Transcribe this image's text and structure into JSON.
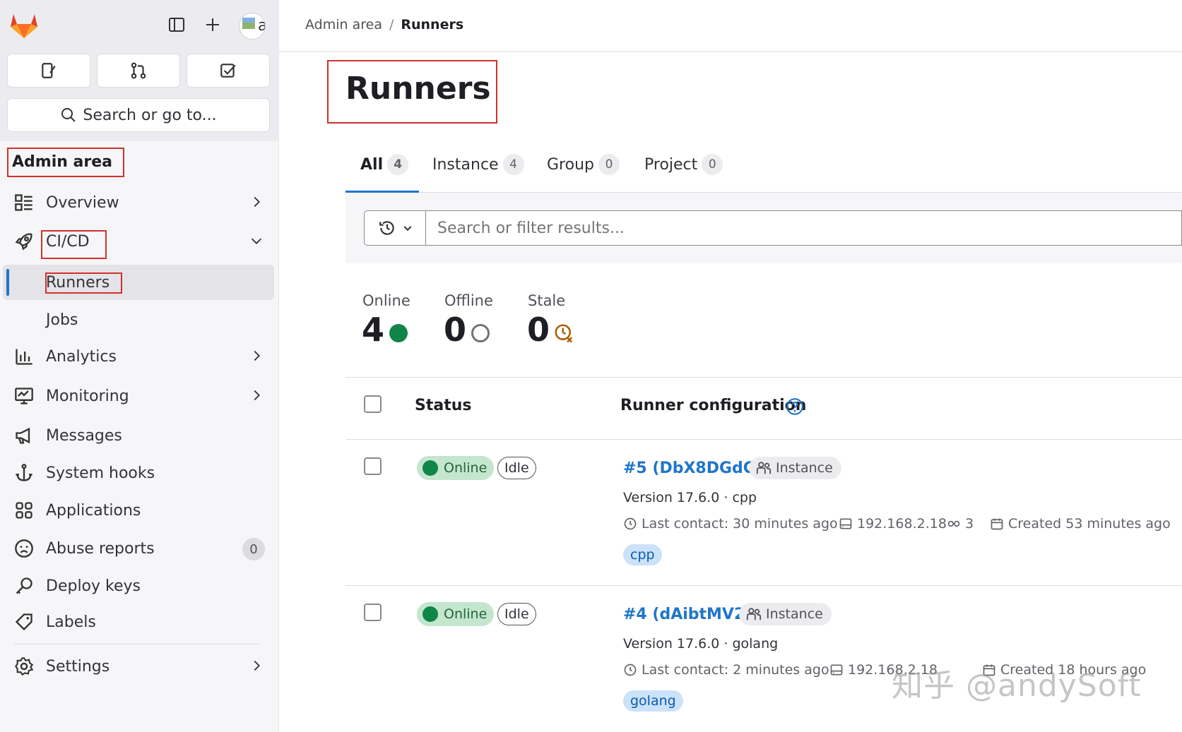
{
  "sidebar": {
    "avatar_alt": "a",
    "search_label": "Search or go to...",
    "section_title": "Admin area",
    "items": [
      {
        "label": "Overview"
      },
      {
        "label": "CI/CD"
      },
      {
        "label": "Runners"
      },
      {
        "label": "Jobs"
      },
      {
        "label": "Analytics"
      },
      {
        "label": "Monitoring"
      },
      {
        "label": "Messages"
      },
      {
        "label": "System hooks"
      },
      {
        "label": "Applications"
      },
      {
        "label": "Abuse reports",
        "badge": "0"
      },
      {
        "label": "Deploy keys"
      },
      {
        "label": "Labels"
      },
      {
        "label": "Settings"
      }
    ]
  },
  "breadcrumb": {
    "parent": "Admin area",
    "separator": "/",
    "current": "Runners"
  },
  "page": {
    "title": "Runners"
  },
  "tabs": [
    {
      "label": "All",
      "count": "4"
    },
    {
      "label": "Instance",
      "count": "4"
    },
    {
      "label": "Group",
      "count": "0"
    },
    {
      "label": "Project",
      "count": "0"
    }
  ],
  "filter": {
    "placeholder": "Search or filter results..."
  },
  "stats": {
    "online": {
      "label": "Online",
      "value": "4"
    },
    "offline": {
      "label": "Offline",
      "value": "0"
    },
    "stale": {
      "label": "Stale",
      "value": "0"
    }
  },
  "table": {
    "headers": {
      "status": "Status",
      "config": "Runner configuration"
    }
  },
  "runners": [
    {
      "status": "Online",
      "state": "Idle",
      "name": "#5 (DbX8DGdG)",
      "type": "Instance",
      "version": "Version 17.6.0 · cpp",
      "last_contact": "Last contact: 30 minutes ago",
      "ip": "192.168.2.18",
      "jobs": "3",
      "created": "Created 53 minutes ago",
      "tag": "cpp"
    },
    {
      "status": "Online",
      "state": "Idle",
      "name": "#4 (dAibtMV2)",
      "type": "Instance",
      "version": "Version 17.6.0 · golang",
      "last_contact": "Last contact: 2 minutes ago",
      "ip": "192.168.2.18",
      "created": "Created 18 hours ago",
      "tag": "golang"
    }
  ],
  "watermark": "知乎 @andySoft",
  "colors": {
    "accent": "#1f75cb",
    "online": "#108548",
    "annotation": "#d0312d"
  }
}
